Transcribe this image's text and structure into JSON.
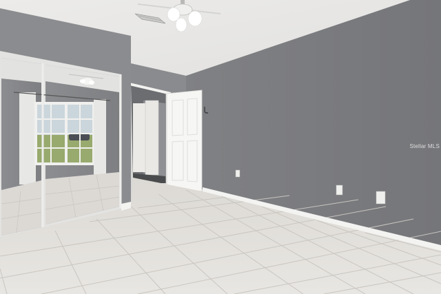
{
  "scene": {
    "description_free": true,
    "colors": {
      "ceiling": "#e8e8e6",
      "wall_right": "#7c7d80",
      "wall_left": "#8a8b8e",
      "wall_back": "#86878a",
      "floor": "#e2e0dc",
      "grout": "#c9c6c0",
      "baseboard": "#f4f4f2",
      "door": "#f5f5f3",
      "mirror_frame": "#dcdcdc",
      "window_sky": "#cfd8dd",
      "curtain": "#e4e4e4"
    },
    "icons": [
      "ceiling-fan-icon",
      "air-vent-icon",
      "outlet-icon",
      "door-hook-icon"
    ]
  },
  "watermark": {
    "text": "Stellar MLS"
  }
}
